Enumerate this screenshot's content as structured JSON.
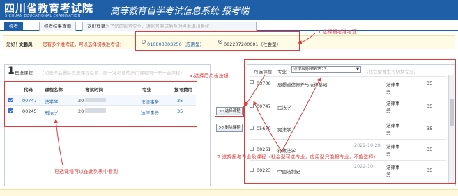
{
  "header": {
    "logo_title": "四川省教育考试院",
    "logo_sub": "SICHUAN EDUCATIONAL EXAMINATION",
    "system_title": "高等教育自学考试信息系统  报考端"
  },
  "tabs": [
    {
      "label": "报考",
      "active": true
    },
    {
      "label": "报考结果查询",
      "active": false
    },
    {
      "label": "退出登录",
      "active": false
    }
  ],
  "tab_note": "为了您的账号安全，请账号完成后及时点此退出系统",
  "infobar": {
    "greet": "您好！",
    "username": "文鹏凤",
    "notice": "您有多个准考证，可以选择切换准考证：",
    "options": [
      {
        "label": "010803303256（应用型）",
        "selected": false
      },
      {
        "label": "082207200001（社会型）",
        "selected": true
      }
    ]
  },
  "left_panel": {
    "number": "1",
    "title": "已选课程",
    "tip": "（如选择后删除已选课程后请，则一准考证的多门课程同一天一合课程）",
    "columns": [
      "代码",
      "课程名称",
      "考试时间",
      "专业",
      "报考费用"
    ],
    "rows": [
      {
        "checked": true,
        "code": "00747",
        "name": "法学学",
        "time": "20",
        "major": "法律事务",
        "fee": "35"
      },
      {
        "checked": true,
        "code": "00245",
        "name": "刑法学",
        "time": "20",
        "major": "法律事务",
        "fee": "35"
      }
    ]
  },
  "buttons": {
    "add": "<<选择课程",
    "remove": ">>删除课程"
  },
  "right_panel": {
    "title": "可选课程",
    "major_label": "专业",
    "major_value": "法律事务H660523",
    "hint": "（社会型考生可切换专业）",
    "rows": [
      {
        "checked": false,
        "code": "03706",
        "name": "思想道德修养与法律基础",
        "time": "",
        "major": "法律事务",
        "fee": "35"
      },
      {
        "checked": false,
        "code": "00747",
        "name": "民法学",
        "time": "",
        "major": "法律事务",
        "fee": "35"
      },
      {
        "checked": false,
        "code": "05679",
        "name": "宪法学",
        "time": "",
        "major": "法律事务",
        "fee": "35"
      },
      {
        "checked": false,
        "code": "00261",
        "name": "行政法学",
        "time": "2022-10-29",
        "major": "法律事务",
        "fee": "35"
      },
      {
        "checked": false,
        "code": "00223",
        "name": "中国法制史",
        "time": "2022-10-",
        "major": "法律事务",
        "fee": "35"
      }
    ]
  },
  "annotations": {
    "step1": "1.选择报考准考证",
    "step2": "2.选择报考专业及课程（社会型可选专业，应用型只能报专业，不能选择）",
    "step3": "3.选择后点击按钮",
    "left_note": "已选课程可以在此列表中看到"
  },
  "colors": {
    "brand": "#1f5fa8",
    "annotation": "#e23b3b",
    "notice": "#d0302b"
  }
}
